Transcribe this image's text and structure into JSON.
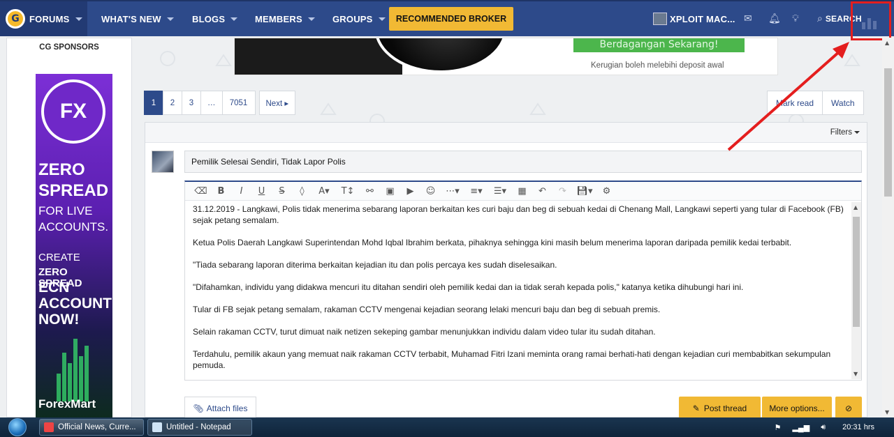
{
  "nav": {
    "brand": "FORUMS",
    "items": [
      "WHAT'S NEW",
      "BLOGS",
      "MEMBERS",
      "GROUPS"
    ],
    "broker": "RECOMMENDED BROKER",
    "user": "XPLOIT MAC...",
    "search": "SEARCH"
  },
  "sidebar": {
    "title": "CG SPONSORS",
    "ad": {
      "logo": "FX",
      "line1": "ZERO",
      "line2": "SPREAD",
      "line3": "FOR LIVE",
      "line4": "ACCOUNTS.",
      "line5": "CREATE",
      "line6": "ZERO SPREAD",
      "line7": "ECN",
      "line8": "ACCOUNT",
      "line9": "NOW!",
      "brand": "ForexMart"
    }
  },
  "banner": {
    "cta": "Berdagangan Sekarang!",
    "note": "Kerugian boleh melebihi deposit awal"
  },
  "pagination": {
    "pages": [
      "1",
      "2",
      "3",
      "…",
      "7051"
    ],
    "next": "Next ▸"
  },
  "actions": {
    "mark_read": "Mark read",
    "watch": "Watch"
  },
  "filters": "Filters",
  "thread": {
    "title": "Pemilik Selesai Sendiri, Tidak Lapor Polis",
    "paragraphs": [
      "31.12.2019 - Langkawi, Polis tidak menerima sebarang laporan berkaitan kes curi baju dan beg di sebuah kedai di Chenang Mall, Langkawi seperti yang tular di Facebook (FB) sejak petang semalam.",
      "Ketua Polis Daerah Langkawi Superintendan Mohd Iqbal Ibrahim berkata, pihaknya sehingga kini masih belum menerima laporan daripada pemilik kedai terbabit.",
      "\"Tiada sebarang laporan diterima berkaitan kejadian itu dan polis percaya kes sudah diselesaikan.",
      "\"Difahamkan, individu yang didakwa mencuri itu ditahan sendiri oleh pemilik kedai dan ia tidak serah kepada polis,\" katanya ketika dihubungi hari ini.",
      "Tular di FB sejak petang semalam, rakaman CCTV mengenai kejadian seorang lelaki mencuri baju dan beg di sebuah premis.",
      "Selain rakaman CCTV, turut dimuat naik netizen sekeping gambar menunjukkan individu dalam video tular itu sudah ditahan.",
      "Terdahulu, pemilik akaun yang memuat naik rakaman CCTV terbabit, Muhamad Fitri Izani meminta orang ramai berhati-hati dengan kejadian curi membabitkan sekumpulan pemuda."
    ]
  },
  "buttons": {
    "attach": "Attach files",
    "post": "Post thread",
    "more": "More options..."
  },
  "taskbar": {
    "items": [
      "Official News, Curre...",
      "Untitled - Notepad"
    ],
    "time": "20:31 hrs"
  },
  "colors": {
    "nav": "#2d4a8a",
    "accent": "#f1b934",
    "annotation": "#e41e1e"
  }
}
